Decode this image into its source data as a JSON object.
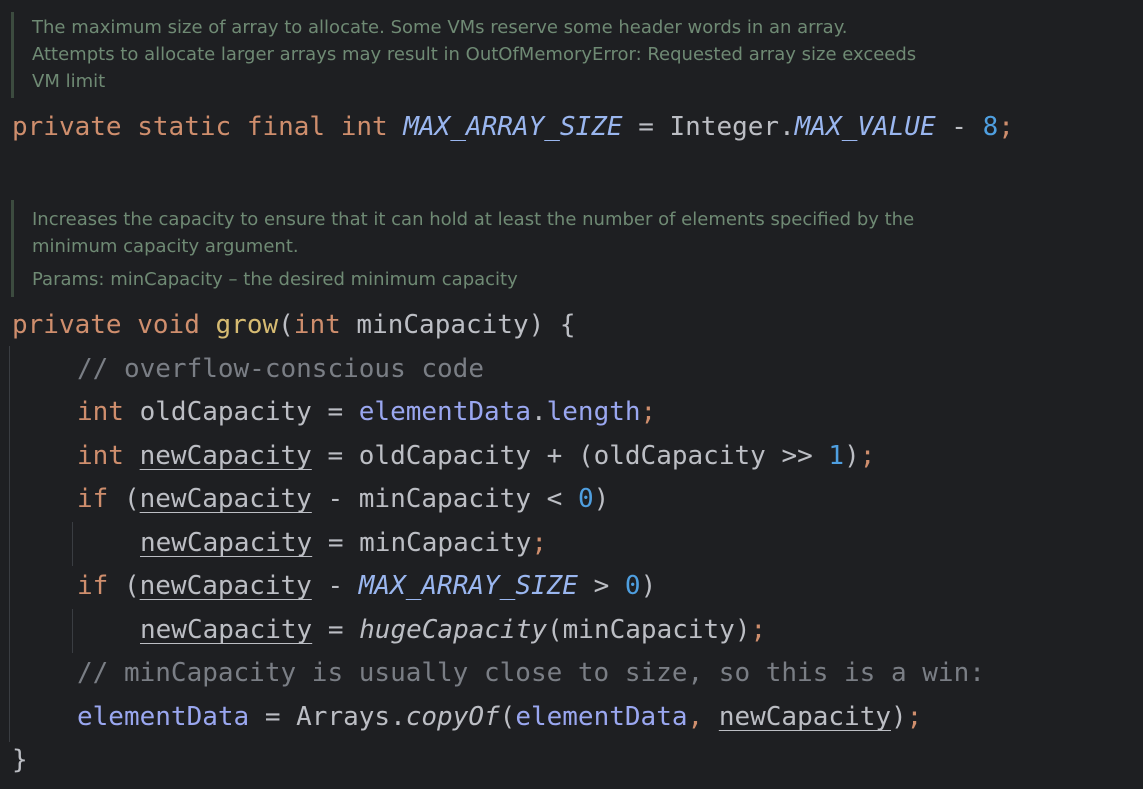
{
  "doc1": {
    "lines": [
      "The maximum size of array to allocate. Some VMs reserve some header words in an array.",
      "Attempts to allocate larger arrays may result in OutOfMemoryError: Requested array size exceeds",
      "VM limit"
    ]
  },
  "decl": {
    "mod1": "private",
    "mod2": "static",
    "mod3": "final",
    "type": "int",
    "name": "MAX_ARRAY_SIZE",
    "eq": "=",
    "cls": "Integer.",
    "const": "MAX_VALUE",
    "minus": "-",
    "num": "8",
    "semi": ";"
  },
  "doc2": {
    "lines": [
      "Increases the capacity to ensure that it can hold at least the number of elements specified by the",
      "minimum capacity argument."
    ],
    "params_label": "Params:",
    "params_text": "minCapacity – the desired minimum capacity"
  },
  "method": {
    "sig_private": "private",
    "sig_void": "void",
    "sig_name": "grow",
    "sig_open": "(",
    "sig_int": "int",
    "sig_param": "minCapacity",
    "sig_close": ") {",
    "comment1": "// overflow-conscious code",
    "l2_int": "int",
    "l2_var": "oldCapacity",
    "l2_eq": "=",
    "l2_field": "elementData",
    "l2_dot": ".",
    "l2_len": "length",
    "l2_semi": ";",
    "l3_int": "int",
    "l3_var": "newCapacity",
    "l3_eq": "=",
    "l3_a": "oldCapacity",
    "l3_plus": "+",
    "l3_open": "(",
    "l3_b": "oldCapacity",
    "l3_shift": ">>",
    "l3_num": "1",
    "l3_close": ")",
    "l3_semi": ";",
    "l4_if": "if",
    "l4_open": "(",
    "l4_var": "newCapacity",
    "l4_minus": "-",
    "l4_b": "minCapacity",
    "l4_lt": "<",
    "l4_num": "0",
    "l4_close": ")",
    "l5_var": "newCapacity",
    "l5_eq": "=",
    "l5_val": "minCapacity",
    "l5_semi": ";",
    "l6_if": "if",
    "l6_open": "(",
    "l6_var": "newCapacity",
    "l6_minus": "-",
    "l6_const": "MAX_ARRAY_SIZE",
    "l6_gt": ">",
    "l6_num": "0",
    "l6_close": ")",
    "l7_var": "newCapacity",
    "l7_eq": "=",
    "l7_call": "hugeCapacity",
    "l7_args": "(minCapacity)",
    "l7_semi": ";",
    "comment2": "// minCapacity is usually close to size, so this is a win:",
    "l9_field": "elementData",
    "l9_eq": "=",
    "l9_cls": "Arrays.",
    "l9_call": "copyOf",
    "l9_open": "(",
    "l9_arg1": "elementData",
    "l9_comma": ",",
    "l9_arg2": "newCapacity",
    "l9_close": ")",
    "l9_semi": ";",
    "close_brace": "}"
  }
}
